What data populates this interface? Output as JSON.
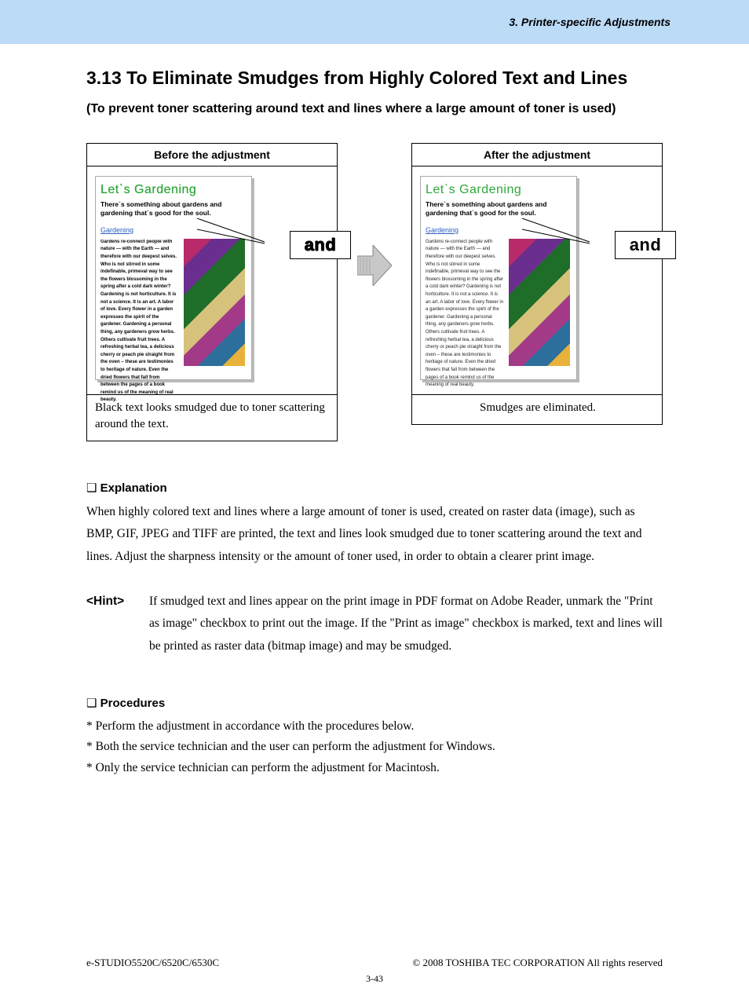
{
  "header": {
    "chapter": "3. Printer-specific Adjustments"
  },
  "title": "3.13 To Eliminate Smudges from Highly Colored Text and Lines",
  "subtitle": "(To prevent toner scattering around text and lines where a large amount of toner is used)",
  "compare": {
    "before": {
      "label": "Before the adjustment",
      "caption": "Black text looks smudged due to toner scattering around the text."
    },
    "after": {
      "label": "After the adjustment",
      "caption": "Smudges are eliminated."
    },
    "sample": {
      "title": "Let`s Gardening",
      "subtitle": "There`s something about gardens and gardening that`s good for the soul.",
      "link": "Gardening",
      "body": "Gardens re-connect people with nature — with the Earth — and therefore with our deepest selves. Who is not stirred in some indefinable, primeval way to see the flowers blossoming in the spring after a cold dark winter? Gardening is not horticulture. It is not a science. It is an art. A labor of love. Every flower in a garden expresses the spirit of the gardener. Gardening a personal thing, any gardeners grow herbs. Others cultivate fruit trees. A refreshing herbal tea, a delicious cherry or peach pie straight from the oven – these are testimonies to heritage of nature. Even the dried flowers that fall from between the pages of a book remind us of the meaning of real beauty.",
      "and": "and"
    }
  },
  "explanation": {
    "heading": "Explanation",
    "text": "When highly colored text and lines where a large amount of toner is used, created on raster data (image), such as BMP, GIF, JPEG and TIFF are printed, the text and lines look smudged due to toner scattering around the text and lines.  Adjust the sharpness intensity or the amount of toner used, in order to obtain a clearer print image."
  },
  "hint": {
    "label": "<Hint>",
    "text": "If smudged text and lines appear on the print image in PDF format on Adobe Reader, unmark the \"Print as image\" checkbox to print out the image.  If the \"Print as image\" checkbox is marked, text and lines will be printed as raster data (bitmap image) and may be smudged."
  },
  "procedures": {
    "heading": "Procedures",
    "items": [
      "Perform the adjustment in accordance with the procedures below.",
      "Both the service technician and the user can perform the adjustment for Windows.",
      "Only the service technician can perform the adjustment for Macintosh."
    ]
  },
  "footer": {
    "left": "e-STUDIO5520C/6520C/6530C",
    "right": "© 2008 TOSHIBA TEC CORPORATION All rights reserved",
    "page": "3-43"
  }
}
